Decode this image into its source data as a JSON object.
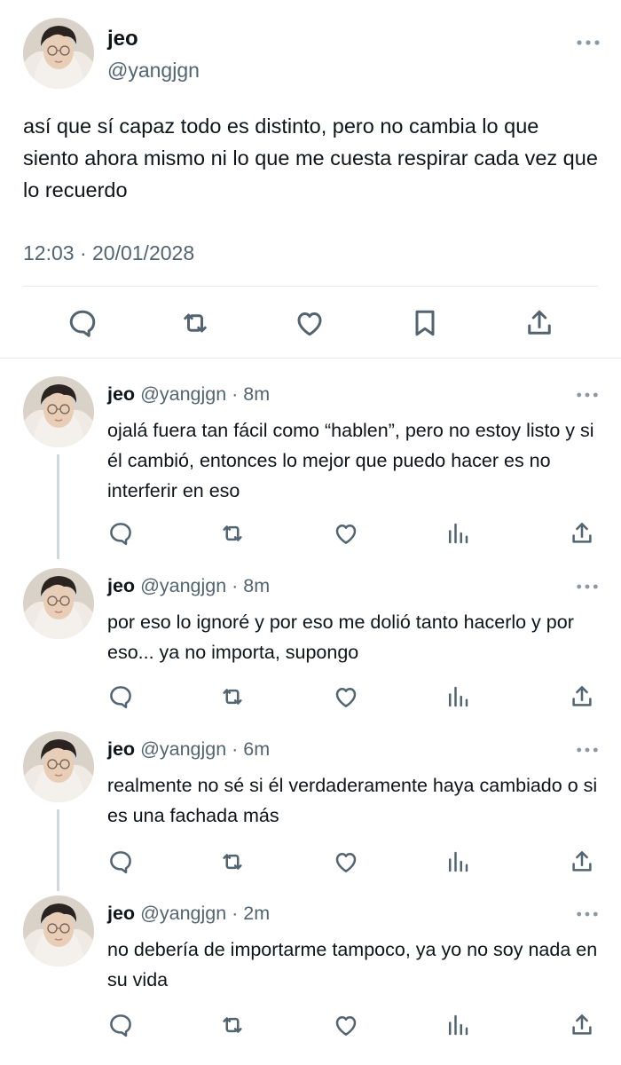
{
  "main_tweet": {
    "name": "jeo",
    "handle": "@yangjgn",
    "text": "así que sí capaz todo es distinto, pero no cambia lo que siento ahora mismo ni lo que me cuesta respirar cada vez que lo recuerdo",
    "timestamp": "12:03 · 20/01/2028",
    "actions": [
      "reply-icon",
      "retweet-icon",
      "like-icon",
      "bookmark-icon",
      "share-icon"
    ]
  },
  "replies": [
    {
      "name": "jeo",
      "meta": "@yangjgn · 8m",
      "text": "ojalá fuera tan fácil como “hablen”, pero no estoy listo y si él cambió, entonces lo mejor que puedo hacer es no interferir en eso"
    },
    {
      "name": "jeo",
      "meta": "@yangjgn · 8m",
      "text": "por eso lo ignoré y por eso me dolió tanto hacerlo y por eso... ya no importa, supongo"
    },
    {
      "name": "jeo",
      "meta": "@yangjgn · 6m",
      "text": "realmente no sé si él verdaderamente haya cambiado o si es una fachada más"
    },
    {
      "name": "jeo",
      "meta": "@yangjgn · 2m",
      "text": "no debería de importarme tampoco, ya yo no soy nada en su vida"
    }
  ],
  "colors": {
    "text": "#0f1419",
    "secondary": "#536471",
    "divider": "#e6e9ec",
    "thread_line": "#cfd9de"
  }
}
